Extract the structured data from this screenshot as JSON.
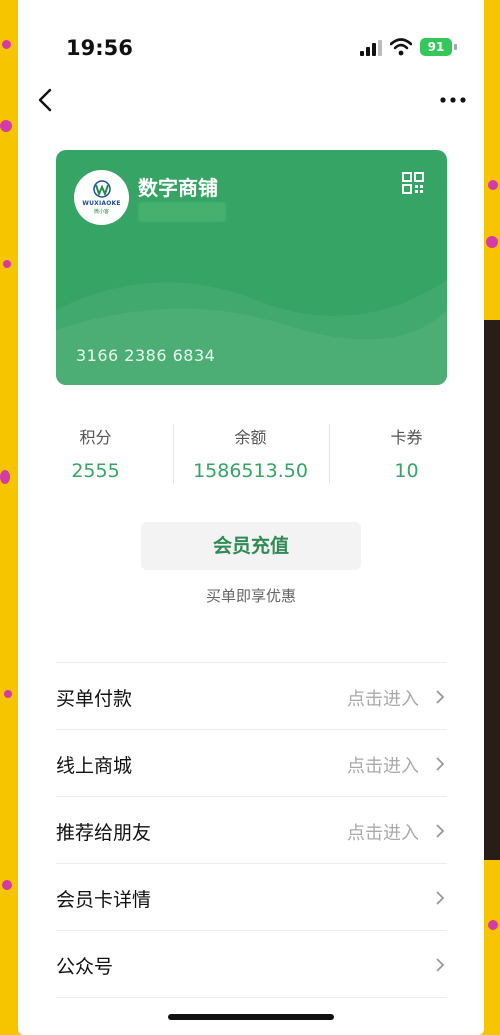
{
  "status_bar": {
    "time": "19:56",
    "battery": "91"
  },
  "card": {
    "logo_top": "WUXIAOKE",
    "logo_bottom": "微小客",
    "store_name": "数字商铺",
    "card_number": "3166 2386 6834"
  },
  "stats": [
    {
      "label": "积分",
      "value": "2555"
    },
    {
      "label": "余额",
      "value": "1586513.50"
    },
    {
      "label": "卡券",
      "value": "10"
    }
  ],
  "recharge": {
    "label": "会员充值",
    "subtitle": "买单即享优惠"
  },
  "menu": [
    {
      "label": "买单付款",
      "hint": "点击进入"
    },
    {
      "label": "线上商城",
      "hint": "点击进入"
    },
    {
      "label": "推荐给朋友",
      "hint": "点击进入"
    },
    {
      "label": "会员卡详情",
      "hint": ""
    },
    {
      "label": "公众号",
      "hint": ""
    }
  ],
  "colors": {
    "brand_green": "#36a464",
    "frame_yellow": "#f7c500",
    "accent_dots": "#d63aa8"
  },
  "icons": [
    "back-arrow-icon",
    "more-dots-icon",
    "qr-code-icon",
    "chevron-right-icon",
    "signal-icon",
    "wifi-icon",
    "battery-icon"
  ]
}
